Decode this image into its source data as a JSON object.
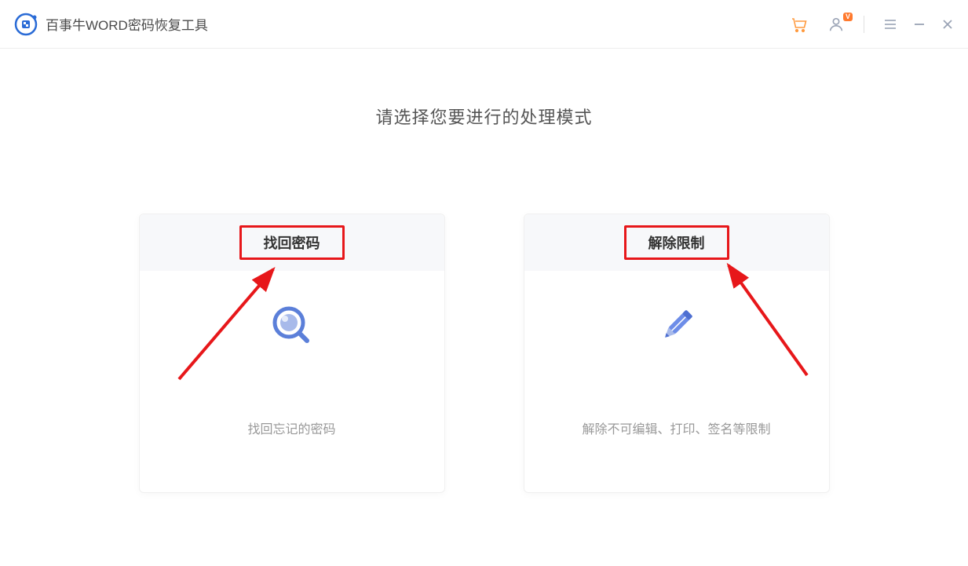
{
  "app": {
    "title": "百事牛WORD密码恢复工具"
  },
  "titlebar": {
    "vip_badge": "V"
  },
  "main": {
    "heading": "请选择您要进行的处理模式",
    "cards": [
      {
        "title": "找回密码",
        "desc": "找回忘记的密码"
      },
      {
        "title": "解除限制",
        "desc": "解除不可编辑、打印、签名等限制"
      }
    ]
  },
  "annotations": {
    "highlight_color": "#e7171a"
  }
}
